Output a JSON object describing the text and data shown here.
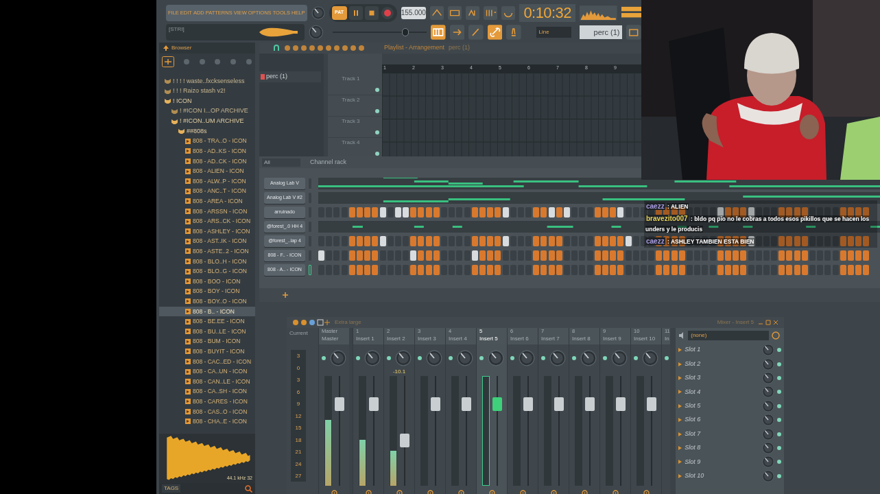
{
  "menu": [
    "FILE",
    "EDIT",
    "ADD",
    "PATTERNS",
    "VIEW",
    "OPTIONS",
    "TOOLS",
    "HELP"
  ],
  "transport": {
    "mode": "PAT",
    "tempo": "155.000",
    "time": "0:10:32"
  },
  "hint": "[STRI]",
  "volume": {
    "level": 0.78
  },
  "snap": "Line",
  "pattern": "perc (1)",
  "browser": {
    "title": "Browser",
    "footer_info": "44.1 kHz 32",
    "tags": "TAGS",
    "tree": [
      {
        "label": "! ! ! ! waste..fxcksenseless",
        "kind": "folder",
        "expanded": false
      },
      {
        "label": "! ! ! Raizo stash v2!",
        "kind": "folder",
        "expanded": false
      },
      {
        "label": "! ICON",
        "kind": "folder",
        "expanded": true,
        "children": [
          {
            "label": "!  #ICON I...OP ARCHIVE",
            "kind": "folder",
            "expanded": false
          },
          {
            "label": "!  #ICON..UM ARCHIVE",
            "kind": "folder",
            "expanded": true,
            "children": [
              {
                "label": "##808s",
                "kind": "folder",
                "expanded": true,
                "children": [
                  {
                    "label": "808 - TRA..O - ICON",
                    "kind": "file",
                    "selected": false
                  },
                  {
                    "label": "808 - AD..KS - ICON",
                    "kind": "file",
                    "selected": false
                  },
                  {
                    "label": "808 - AD..CK - ICON",
                    "kind": "file",
                    "selected": false
                  },
                  {
                    "label": "808 - ALIEN - ICON",
                    "kind": "file",
                    "selected": false
                  },
                  {
                    "label": "808 - ALW..P - ICON",
                    "kind": "file",
                    "selected": false
                  },
                  {
                    "label": "808 - ANC..T - ICON",
                    "kind": "file",
                    "selected": false
                  },
                  {
                    "label": "808 - AREA - ICON",
                    "kind": "file",
                    "selected": false
                  },
                  {
                    "label": "808 - ARSSN - ICON",
                    "kind": "file",
                    "selected": false
                  },
                  {
                    "label": "808 - ARS..CK - ICON",
                    "kind": "file",
                    "selected": false
                  },
                  {
                    "label": "808 - ASHLEY - ICON",
                    "kind": "file",
                    "selected": false
                  },
                  {
                    "label": "808 - AST..IK - ICON",
                    "kind": "file",
                    "selected": false
                  },
                  {
                    "label": "808 - ASTE..2 - ICON",
                    "kind": "file",
                    "selected": false
                  },
                  {
                    "label": "808 - BLO..H - ICON",
                    "kind": "file",
                    "selected": false
                  },
                  {
                    "label": "808 - BLO..G - ICON",
                    "kind": "file",
                    "selected": false
                  },
                  {
                    "label": "808 - BOO - ICON",
                    "kind": "file",
                    "selected": false
                  },
                  {
                    "label": "808 - BOY - ICON",
                    "kind": "file",
                    "selected": false
                  },
                  {
                    "label": "808 - BOY..O - ICON",
                    "kind": "file",
                    "selected": false
                  },
                  {
                    "label": "808 - B.. - ICON",
                    "kind": "file",
                    "selected": true
                  },
                  {
                    "label": "808 - BE.EE - ICON",
                    "kind": "file",
                    "selected": false
                  },
                  {
                    "label": "808 - BU..LE - ICON",
                    "kind": "file",
                    "selected": false
                  },
                  {
                    "label": "808 - BUM - ICON",
                    "kind": "file",
                    "selected": false
                  },
                  {
                    "label": "808 - BUYIT - ICON",
                    "kind": "file",
                    "selected": false
                  },
                  {
                    "label": "808 - CAC..ED - ICON",
                    "kind": "file",
                    "selected": false
                  },
                  {
                    "label": "808 - CA..UN - ICON",
                    "kind": "file",
                    "selected": false
                  },
                  {
                    "label": "808 - CAN..LE - ICON",
                    "kind": "file",
                    "selected": false
                  },
                  {
                    "label": "808 - CA..SH - ICON",
                    "kind": "file",
                    "selected": false
                  },
                  {
                    "label": "808 - CARES - ICON",
                    "kind": "file",
                    "selected": false
                  },
                  {
                    "label": "808 - CAS..O - ICON",
                    "kind": "file",
                    "selected": false
                  },
                  {
                    "label": "808 - CHA..E - ICON",
                    "kind": "file",
                    "selected": false
                  }
                ]
              }
            ]
          }
        ]
      }
    ]
  },
  "playlist": {
    "title": "Playlist - Arrangement",
    "pattern": "perc (1)",
    "patterns": [
      "perc (1)"
    ],
    "bars": [
      "1",
      "2",
      "3",
      "4",
      "5",
      "6",
      "7",
      "8",
      "9"
    ],
    "tracks": [
      "Track 1",
      "Track 2",
      "Track 3",
      "Track 4"
    ]
  },
  "channel_rack": {
    "title": "Channel rack",
    "filter": "All",
    "channels": [
      {
        "name": "Analog Lab V",
        "kind": "notes",
        "selected": false
      },
      {
        "name": "Analog Lab V #2",
        "kind": "notes",
        "selected": false
      },
      {
        "name": "arruinado",
        "kind": "steps",
        "selected": false,
        "steps": [
          false,
          false,
          false,
          false,
          true,
          true,
          true,
          true,
          false,
          false,
          false,
          false,
          true,
          true,
          true,
          true,
          false,
          false,
          false,
          false,
          true,
          true,
          true,
          true,
          false,
          false,
          false,
          false,
          true,
          true,
          false,
          true,
          false,
          false,
          false,
          false,
          true,
          true,
          true,
          false,
          false,
          false,
          false,
          false,
          true,
          true,
          true,
          true,
          false,
          false,
          false,
          false,
          false,
          true,
          true,
          true,
          false,
          false,
          false,
          false,
          true,
          true,
          true,
          true,
          false,
          false,
          false,
          false,
          true,
          true,
          true,
          true
        ],
        "accents": [
          false,
          false,
          false,
          false,
          false,
          false,
          false,
          false,
          true,
          false,
          true,
          true,
          false,
          false,
          false,
          false,
          false,
          false,
          false,
          false,
          false,
          false,
          false,
          false,
          true,
          false,
          false,
          false,
          false,
          false,
          true,
          false,
          true,
          false,
          false,
          false,
          false,
          false,
          false,
          true,
          false,
          false,
          false,
          false,
          false,
          false,
          false,
          false,
          false,
          false,
          false,
          false,
          true,
          false,
          false,
          false,
          true,
          false,
          false,
          false,
          false,
          false,
          false,
          false,
          false,
          false,
          false,
          false,
          false,
          false,
          false,
          false
        ]
      },
      {
        "name": "@forest_.0 HH 4",
        "kind": "notes",
        "selected": false
      },
      {
        "name": "@forest_..lap 4",
        "kind": "steps",
        "selected": false,
        "steps": [
          false,
          false,
          false,
          false,
          true,
          true,
          true,
          true,
          false,
          false,
          false,
          false,
          true,
          true,
          true,
          true,
          false,
          false,
          false,
          false,
          true,
          true,
          true,
          true,
          false,
          false,
          false,
          false,
          true,
          true,
          true,
          true,
          false,
          false,
          false,
          false,
          true,
          true,
          true,
          true,
          false,
          false,
          false,
          false,
          true,
          true,
          true,
          true,
          false,
          false,
          false,
          false,
          true,
          true,
          true,
          true,
          false,
          false,
          false,
          false,
          true,
          true,
          true,
          true,
          false,
          false,
          false,
          false,
          true,
          true,
          true,
          true
        ],
        "accents": [
          false,
          false,
          false,
          false,
          false,
          false,
          false,
          false,
          true,
          false,
          false,
          false,
          false,
          false,
          false,
          false,
          false,
          false,
          false,
          false,
          false,
          false,
          false,
          false,
          true,
          false,
          false,
          false,
          false,
          false,
          false,
          false,
          false,
          false,
          false,
          false,
          false,
          false,
          false,
          false,
          true,
          false,
          false,
          false,
          false,
          false,
          false,
          false,
          false,
          false,
          false,
          false,
          false,
          false,
          false,
          false,
          true,
          false,
          false,
          false,
          false,
          false,
          false,
          false,
          false,
          false,
          false,
          false,
          false,
          false,
          false,
          false
        ]
      },
      {
        "name": "808 - F.. - ICON",
        "kind": "steps",
        "selected": false,
        "steps": [
          false,
          false,
          false,
          false,
          true,
          true,
          true,
          true,
          false,
          false,
          false,
          false,
          false,
          true,
          true,
          true,
          false,
          false,
          false,
          false,
          false,
          true,
          true,
          true,
          false,
          false,
          false,
          false,
          true,
          true,
          true,
          true,
          false,
          false,
          false,
          false,
          true,
          true,
          true,
          true,
          false,
          false,
          false,
          false,
          true,
          true,
          true,
          true,
          false,
          false,
          false,
          false,
          true,
          true,
          true,
          true,
          false,
          false,
          false,
          false,
          true,
          true,
          true,
          true,
          false,
          false,
          false,
          false,
          true,
          true,
          true,
          true
        ],
        "accents": [
          true,
          false,
          false,
          false,
          false,
          false,
          false,
          false,
          false,
          false,
          false,
          false,
          true,
          false,
          false,
          false,
          false,
          false,
          false,
          false,
          true,
          false,
          false,
          false,
          false,
          false,
          false,
          false,
          false,
          false,
          false,
          false,
          false,
          false,
          false,
          false,
          false,
          false,
          false,
          false,
          false,
          false,
          false,
          false,
          false,
          false,
          false,
          false,
          false,
          false,
          false,
          false,
          false,
          false,
          false,
          false,
          false,
          false,
          false,
          false,
          false,
          false,
          false,
          false,
          false,
          false,
          false,
          false,
          false,
          false,
          false,
          false
        ]
      },
      {
        "name": "808 - A.. - ICON",
        "kind": "steps",
        "selected": true,
        "steps": [
          false,
          false,
          false,
          false,
          true,
          true,
          true,
          true,
          false,
          false,
          false,
          false,
          true,
          true,
          true,
          true,
          false,
          false,
          false,
          false,
          true,
          true,
          true,
          true,
          false,
          false,
          false,
          false,
          true,
          true,
          true,
          true,
          false,
          false,
          false,
          false,
          true,
          true,
          true,
          true,
          false,
          false,
          false,
          false,
          true,
          true,
          true,
          true,
          false,
          false,
          false,
          false,
          true,
          true,
          true,
          true,
          false,
          false,
          false,
          false,
          true,
          true,
          true,
          true,
          false,
          false,
          false,
          false,
          true,
          true,
          true,
          true
        ],
        "accents": [
          false,
          false,
          false,
          false,
          false,
          false,
          false,
          false,
          false,
          false,
          false,
          false,
          false,
          false,
          false,
          false,
          false,
          false,
          false,
          false,
          false,
          false,
          false,
          false,
          false,
          false,
          false,
          false,
          false,
          false,
          false,
          false,
          false,
          false,
          false,
          false,
          false,
          false,
          false,
          false,
          false,
          false,
          false,
          false,
          false,
          false,
          false,
          false,
          false,
          false,
          false,
          false,
          false,
          false,
          false,
          false,
          false,
          false,
          false,
          false,
          false,
          false,
          false,
          false,
          false,
          false,
          false,
          false,
          false,
          false,
          false,
          false
        ]
      }
    ]
  },
  "mixer": {
    "title": "Mixer - Insert 5",
    "size": "Extra large",
    "current": {
      "label": "Current",
      "scale": [
        "3",
        "0",
        "3",
        "6",
        "9",
        "12",
        "15",
        "18",
        "21",
        "24",
        "27"
      ]
    },
    "strips": [
      {
        "number": "Master",
        "name": "Master",
        "selected": false,
        "fader": {
          "level": 0.78
        },
        "meter": {
          "level": 0.6
        }
      },
      {
        "number": "1",
        "name": "Insert 1",
        "selected": false,
        "fader": {
          "level": 0.78
        },
        "meter": {
          "level": 0.42
        }
      },
      {
        "number": "2",
        "name": "Insert 2",
        "selected": false,
        "readout": "-10.1",
        "fader": {
          "level": 0.4
        },
        "meter": {
          "level": 0.32
        }
      },
      {
        "number": "3",
        "name": "Insert 3",
        "selected": false,
        "fader": {
          "level": 0.78
        }
      },
      {
        "number": "4",
        "name": "Insert 4",
        "selected": false,
        "fader": {
          "level": 0.78
        }
      },
      {
        "number": "5",
        "name": "Insert 5",
        "selected": true,
        "fader": {
          "level": 0.78
        }
      },
      {
        "number": "6",
        "name": "Insert 6",
        "selected": false,
        "fader": {
          "level": 0.78
        }
      },
      {
        "number": "7",
        "name": "Insert 7",
        "selected": false,
        "fader": {
          "level": 0.78
        }
      },
      {
        "number": "8",
        "name": "Insert 8",
        "selected": false,
        "fader": {
          "level": 0.78
        }
      },
      {
        "number": "9",
        "name": "Insert 9",
        "selected": false,
        "fader": {
          "level": 0.78
        }
      },
      {
        "number": "10",
        "name": "Insert 10",
        "selected": false,
        "fader": {
          "level": 0.78
        }
      },
      {
        "number": "11",
        "name": "In",
        "selected": false
      }
    ],
    "preset": "(none)",
    "slots": [
      "Slot 1",
      "Slot 2",
      "Slot 3",
      "Slot 4",
      "Slot 5",
      "Slot 6",
      "Slot 7",
      "Slot 8",
      "Slot 9",
      "Slot 10"
    ]
  },
  "chat": [
    {
      "user": "caezz",
      "color": "#a99be0",
      "text": ": ALIEN"
    },
    {
      "user": "bravezito007",
      "color": "#e6d25a",
      "text": ": bldo pq pio no le cobras a todos esos pikillos que se hacen los unders y le producis"
    },
    {
      "user": "caezz",
      "color": "#a99be0",
      "text": ": ASHLEY TAMBIEN ESTA BIEN"
    }
  ]
}
